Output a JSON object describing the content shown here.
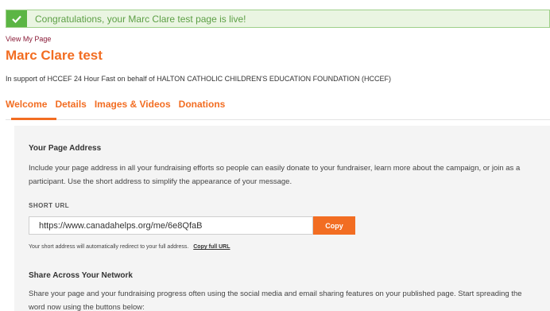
{
  "banner": {
    "icon": "check-icon",
    "message": "Congratulations, your Marc Clare test page is live!",
    "accent_color": "#5bb544"
  },
  "header": {
    "view_link": "View My Page",
    "title": "Marc Clare test",
    "support": "In support of HCCEF 24 Hour Fast on behalf of HALTON CATHOLIC CHILDREN'S EDUCATION FOUNDATION (HCCEF)"
  },
  "tabs": [
    {
      "label": "Welcome",
      "active": true
    },
    {
      "label": "Details"
    },
    {
      "label": "Images & Videos"
    },
    {
      "label": "Donations"
    }
  ],
  "page_address": {
    "title": "Your Page Address",
    "description": "Include your page address in all your fundraising efforts so people can easily donate to your fundraiser, learn more about the campaign, or join as a participant. Use the short address to simplify the appearance of your message.",
    "short_url_label": "SHORT URL",
    "short_url": "https://www.canadahelps.org/me/6e8QfaB",
    "copy_label": "Copy",
    "redirect_note": "Your short address will automatically redirect to your full address.",
    "copy_full_label": "Copy full URL"
  },
  "share": {
    "title": "Share Across Your Network",
    "description": "Share your page and your fundraising progress often using the social media and email sharing features on your published page. Start spreading the word now using the buttons below:"
  },
  "brand_color": "#f26d22"
}
